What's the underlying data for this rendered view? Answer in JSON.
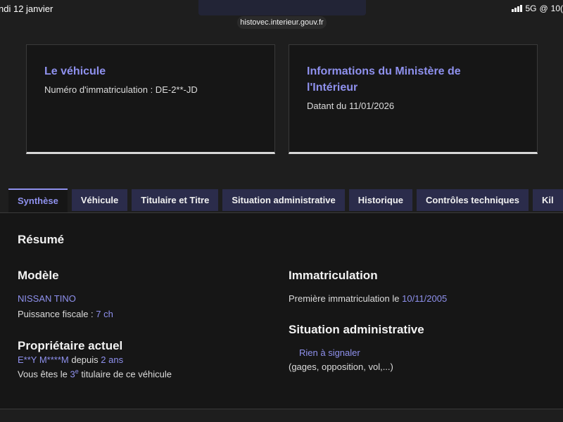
{
  "status": {
    "date": "ndi 12 janvier",
    "network": "5G",
    "battery": "10("
  },
  "browser": {
    "url": "histovec.interieur.gouv.fr"
  },
  "card_vehicle": {
    "title": "Le véhicule",
    "plate_label": "Numéro d'immatriculation : DE-2**-JD"
  },
  "card_ministry": {
    "title": "Informations du Ministère de l'Intérieur",
    "date_label": "Datant du 11/01/2026"
  },
  "tabs": [
    {
      "label": "Synthèse"
    },
    {
      "label": "Véhicule"
    },
    {
      "label": "Titulaire et Titre"
    },
    {
      "label": "Situation administrative"
    },
    {
      "label": "Historique"
    },
    {
      "label": "Contrôles techniques"
    },
    {
      "label": "Kil"
    }
  ],
  "summary": {
    "title": "Résumé",
    "model": {
      "heading": "Modèle",
      "name": "NISSAN TINO",
      "power_label": "Puissance fiscale : ",
      "power_value": "7 ch"
    },
    "owner": {
      "heading": "Propriétaire actuel",
      "name": "E**Y M****M",
      "since_label": " depuis ",
      "since_value": "2 ans",
      "rank_prefix": "Vous êtes le ",
      "rank_value": "3",
      "rank_sup": "e",
      "rank_suffix": " titulaire de ce véhicule"
    },
    "registration": {
      "heading": "Immatriculation",
      "first_label": "Première immatriculation le ",
      "first_date": "10/11/2005"
    },
    "admin": {
      "heading": "Situation administrative",
      "status": "Rien à signaler",
      "details": "(gages, opposition, vol,...)"
    }
  }
}
